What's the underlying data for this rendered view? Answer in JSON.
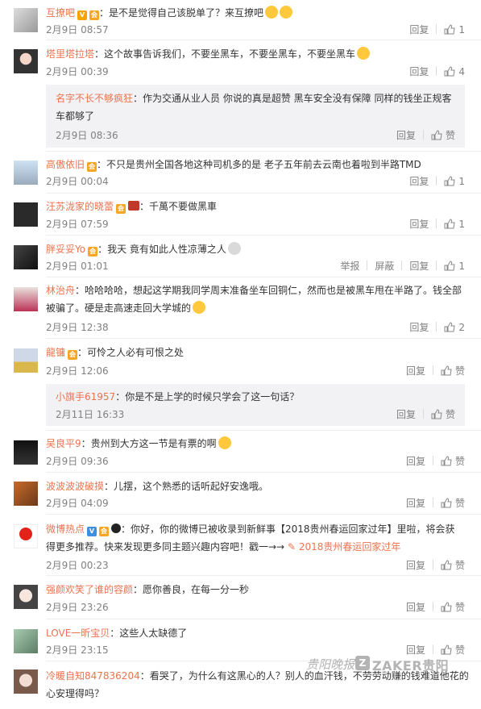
{
  "comments": [
    {
      "name": "互撩吧",
      "text": "：是不是觉得自己该脱单了？来互撩吧",
      "time": "2月9日 08:57",
      "reply": "回复",
      "likes": "1"
    },
    {
      "name": "塔里塔拉塔",
      "text": "：这个故事告诉我们，不要坐黑车，不要坐黑车，不要坐黑车",
      "time": "2月9日 00:39",
      "reply": "回复",
      "likes": "4"
    },
    {
      "name": "名字不长不够疯狂",
      "text": "：作为交通从业人员 你说的真是超赞 黑车安全没有保障 同样的钱坐正规客",
      "text2": "车都够了",
      "time": "2月9日 08:36",
      "reply": "回复",
      "likes": "赞"
    },
    {
      "name": "高傲依旧",
      "text": "：不只是贵州全国各地这种司机多的是 老子五年前去云南也着啦到半路TMD",
      "time": "2月9日 00:04",
      "reply": "回复",
      "likes": "1"
    },
    {
      "name": "汪苏泷家的晓蕾",
      "text": "：千萬不要做黑車",
      "time": "2月9日 07:59",
      "reply": "回复",
      "likes": "1"
    },
    {
      "name": "胖妥妥Yo",
      "text": "：我天  竟有如此人性凉薄之人",
      "time": "2月9日 01:01",
      "report": "举报",
      "block": "屏蔽",
      "reply": "回复",
      "likes": "1"
    },
    {
      "name": "林治舟",
      "text": "：哈哈哈哈，想起这学期我同学周末准备坐车回铜仁，然而也是被黑车甩在半路了。钱全部",
      "text2": "被骗了。硬是走高速走回大学城的",
      "time": "2月9日 12:38",
      "reply": "回复",
      "likes": "2"
    },
    {
      "name": "龍镛",
      "text": "：可怜之人必有可恨之处",
      "time": "2月9日 12:06",
      "reply": "回复",
      "likes": "赞"
    },
    {
      "name": "小旗手61957",
      "text": "：你是不是上学的时候只学会了这一句话？",
      "time": "2月11日 16:33",
      "reply": "回复",
      "likes": "赞"
    },
    {
      "name": "吴良平9",
      "text": "：贵州到大方这一节是有票的啊",
      "time": "2月9日 09:36",
      "reply": "回复",
      "likes": "赞"
    },
    {
      "name": "波波波波破摸",
      "text": "：儿摆，这个熟悉的话听起好安逸哦。",
      "time": "2月9日 04:09",
      "reply": "回复",
      "likes": "赞"
    },
    {
      "name": "微博热点",
      "text": "：你好，你的微博已被收录到新鲜事【2018贵州春运回家过年】里啦，将会获",
      "text2a": "得更多推荐。快来发现更多同主题兴趣内容吧！戳一→→ ",
      "link": "2018贵州春运回家过年",
      "time": "2月9日 00:23",
      "reply": "回复",
      "likes": "赞"
    },
    {
      "name": "强颜欢笑了谁的容颜",
      "text": "：愿你善良，在每一分一秒",
      "time": "2月9日 23:26",
      "reply": "回复",
      "likes": "赞"
    },
    {
      "name": "LOVE一昕宝贝",
      "text": "：这些人太缺德了",
      "time": "2月9日 23:15",
      "reply": "回复",
      "likes": "赞"
    },
    {
      "name": "冷暖自知847836204",
      "text": "：看哭了，为什么有这黑心的人？别人的血汗钱，不劳劳动赚的钱难道他花的",
      "text2": "心安理得吗？"
    }
  ],
  "watermark": {
    "text1": "贵阳晚报",
    "z": "Z",
    "text2": "ZAKER贵阳"
  },
  "colors": {
    "name": "#eb7350",
    "meta": "#808080",
    "text": "#333333",
    "subBg": "#f2f2f5"
  }
}
